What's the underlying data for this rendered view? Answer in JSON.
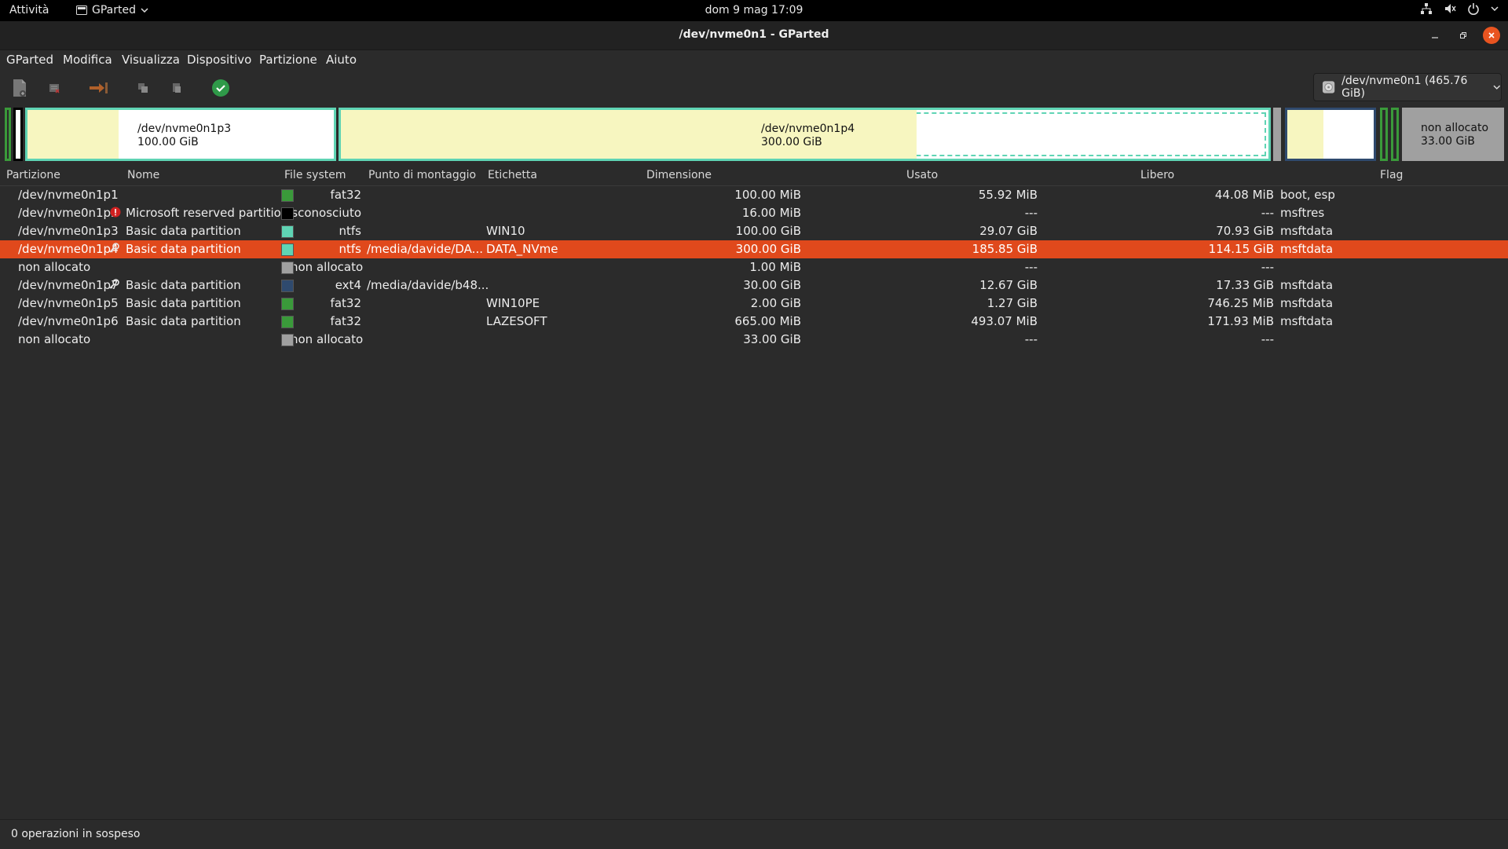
{
  "topbar": {
    "activities": "Attività",
    "app_name": "GParted",
    "clock": "dom 9 mag  17:09"
  },
  "window": {
    "title": "/dev/nvme0n1 - GParted"
  },
  "menubar": [
    "GParted",
    "Modifica",
    "Visualizza",
    "Dispositivo",
    "Partizione",
    "Aiuto"
  ],
  "toolbar": {
    "device_selector": "/dev/nvme0n1 (465.76 GiB)"
  },
  "diskmap": {
    "p3": {
      "name": "/dev/nvme0n1p3",
      "size": "100.00 GiB"
    },
    "p4": {
      "name": "/dev/nvme0n1p4",
      "size": "300.00 GiB"
    },
    "unalloc": {
      "name": "non allocato",
      "size": "33.00 GiB"
    }
  },
  "columns": [
    "Partizione",
    "Nome",
    "File system",
    "Punto di montaggio",
    "Etichetta",
    "Dimensione",
    "Usato",
    "Libero",
    "Flag"
  ],
  "rows": [
    {
      "partition": "/dev/nvme0n1p1",
      "name": "",
      "fs": "fat32",
      "fs_color": "#3a9a3a",
      "mount": "",
      "label": "",
      "size": "100.00 MiB",
      "used": "55.92 MiB",
      "free": "44.08 MiB",
      "flags": "boot, esp",
      "icon": ""
    },
    {
      "partition": "/dev/nvme0n1p2",
      "name": "Microsoft reserved partition",
      "fs": "sconosciuto",
      "fs_color": "#000000",
      "mount": "",
      "label": "",
      "size": "16.00 MiB",
      "used": "---",
      "free": "---",
      "flags": "msftres",
      "icon": "warning"
    },
    {
      "partition": "/dev/nvme0n1p3",
      "name": "Basic data partition",
      "fs": "ntfs",
      "fs_color": "#5fd4b4",
      "mount": "",
      "label": "WIN10",
      "size": "100.00 GiB",
      "used": "29.07 GiB",
      "free": "70.93 GiB",
      "flags": "msftdata",
      "icon": ""
    },
    {
      "partition": "/dev/nvme0n1p4",
      "name": "Basic data partition",
      "fs": "ntfs",
      "fs_color": "#5fd4b4",
      "mount": "/media/davide/DA...",
      "label": "DATA_NVme",
      "size": "300.00 GiB",
      "used": "185.85 GiB",
      "free": "114.15 GiB",
      "flags": "msftdata",
      "icon": "key",
      "selected": true
    },
    {
      "partition": "non allocato",
      "name": "",
      "fs": "non allocato",
      "fs_color": "#a0a0a0",
      "mount": "",
      "label": "",
      "size": "1.00 MiB",
      "used": "---",
      "free": "---",
      "flags": "",
      "icon": ""
    },
    {
      "partition": "/dev/nvme0n1p7",
      "name": "Basic data partition",
      "fs": "ext4",
      "fs_color": "#2f4a6e",
      "mount": "/media/davide/b48...",
      "label": "",
      "size": "30.00 GiB",
      "used": "12.67 GiB",
      "free": "17.33 GiB",
      "flags": "msftdata",
      "icon": "key"
    },
    {
      "partition": "/dev/nvme0n1p5",
      "name": "Basic data partition",
      "fs": "fat32",
      "fs_color": "#3a9a3a",
      "mount": "",
      "label": "WIN10PE",
      "size": "2.00 GiB",
      "used": "1.27 GiB",
      "free": "746.25 MiB",
      "flags": "msftdata",
      "icon": ""
    },
    {
      "partition": "/dev/nvme0n1p6",
      "name": "Basic data partition",
      "fs": "fat32",
      "fs_color": "#3a9a3a",
      "mount": "",
      "label": "LAZESOFT",
      "size": "665.00 MiB",
      "used": "493.07 MiB",
      "free": "171.93 MiB",
      "flags": "msftdata",
      "icon": ""
    },
    {
      "partition": "non allocato",
      "name": "",
      "fs": "non allocato",
      "fs_color": "#a0a0a0",
      "mount": "",
      "label": "",
      "size": "33.00 GiB",
      "used": "---",
      "free": "---",
      "flags": "",
      "icon": ""
    }
  ],
  "status": {
    "text": "0 operazioni in sospeso"
  }
}
